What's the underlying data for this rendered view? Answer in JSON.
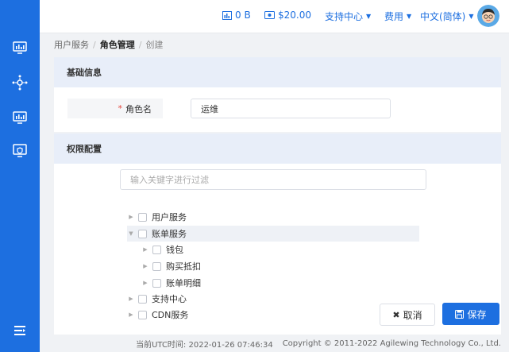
{
  "topbar": {
    "traffic": "0 B",
    "balance": "$20.00",
    "support": "支持中心",
    "fees": "费用",
    "language": "中文(简体)"
  },
  "sidebar": {
    "icons": [
      "monitor-chart-icon",
      "network-node-icon",
      "monitor-chart-icon",
      "shield-check-icon"
    ],
    "bottom_icon": "collapse-menu-icon"
  },
  "breadcrumb": {
    "items": [
      "用户服务",
      "角色管理",
      "创建"
    ]
  },
  "basic": {
    "title": "基础信息",
    "role_label": "角色名",
    "role_required": "*",
    "role_value": "运维"
  },
  "permissions": {
    "title": "权限配置",
    "filter_placeholder": "输入关键字进行过滤",
    "tree": [
      {
        "label": "用户服务",
        "expanded": false,
        "level": 0
      },
      {
        "label": "账单服务",
        "expanded": true,
        "level": 0
      },
      {
        "label": "钱包",
        "expanded": false,
        "level": 1
      },
      {
        "label": "购买抵扣",
        "expanded": false,
        "level": 1
      },
      {
        "label": "账单明细",
        "expanded": false,
        "level": 1
      },
      {
        "label": "支持中心",
        "expanded": false,
        "level": 0
      },
      {
        "label": "CDN服务",
        "expanded": false,
        "level": 0
      }
    ]
  },
  "actions": {
    "cancel": "取消",
    "save": "保存"
  },
  "footer": {
    "utc_time": "当前UTC时间: 2022-01-26 07:46:34",
    "copyright": "Copyright © 2011-2022 Agilewing Technology Co., Ltd."
  },
  "colors": {
    "primary": "#1d6fe0",
    "section_bg": "#e8eef9",
    "required": "#e5483f"
  }
}
